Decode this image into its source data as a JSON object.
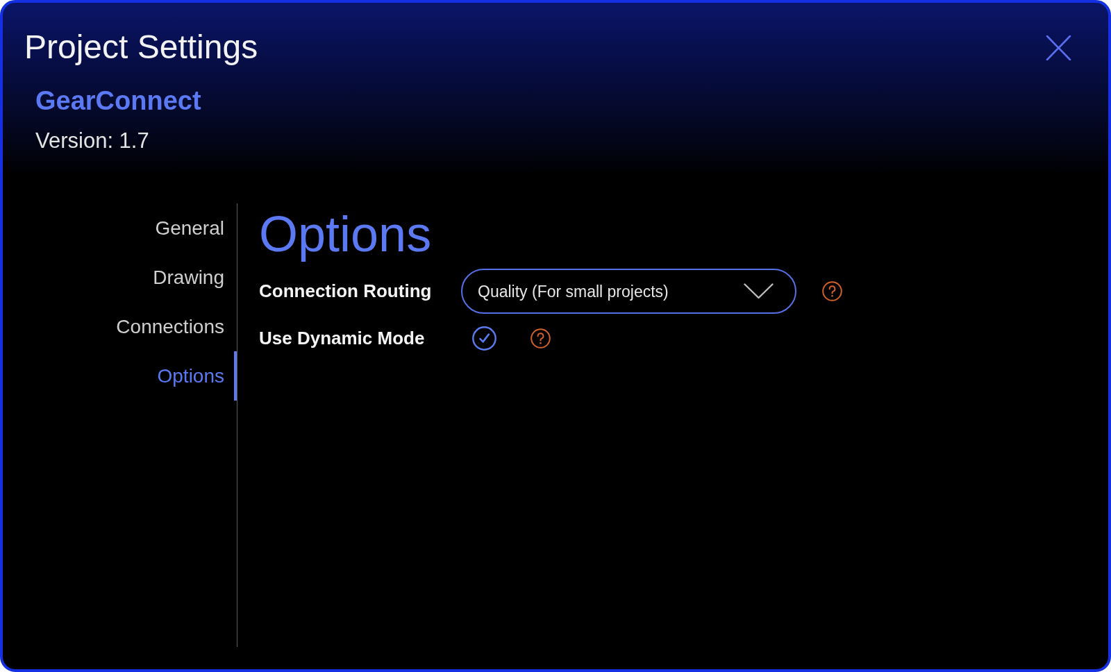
{
  "window": {
    "title": "Project Settings"
  },
  "project": {
    "name": "GearConnect",
    "version": "Version: 1.7"
  },
  "sidebar": {
    "items": [
      {
        "label": "General",
        "selected": false
      },
      {
        "label": "Drawing",
        "selected": false
      },
      {
        "label": "Connections",
        "selected": false
      },
      {
        "label": "Options",
        "selected": true
      }
    ]
  },
  "panel": {
    "heading": "Options",
    "settings": [
      {
        "kind": "dropdown",
        "label": "Connection Routing",
        "value": "Quality (For small projects)"
      },
      {
        "kind": "checkbox",
        "label": "Use Dynamic Mode",
        "checked": true
      }
    ]
  }
}
